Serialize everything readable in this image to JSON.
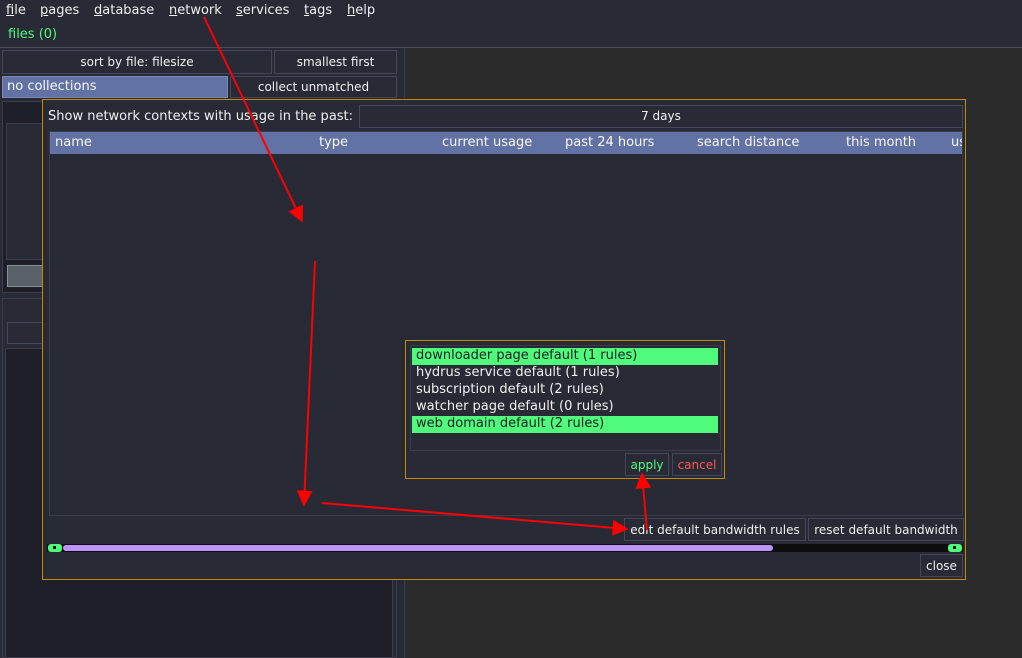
{
  "menubar": {
    "items": [
      {
        "key": "f",
        "rest": "ile"
      },
      {
        "key": "p",
        "rest": "ages"
      },
      {
        "key": "d",
        "rest": "atabase"
      },
      {
        "key": "n",
        "rest": "etwork"
      },
      {
        "key": "s",
        "rest": "ervices"
      },
      {
        "key": "t",
        "rest": "ags"
      },
      {
        "key": "h",
        "rest": "elp"
      }
    ]
  },
  "tabs": {
    "files_label": "files (0)"
  },
  "left_panel": {
    "sort_label": "sort by file: filesize",
    "order_label": "smallest first",
    "collections_label": "no collections",
    "collect_label": "collect unmatched"
  },
  "dialog": {
    "past_label": "Show network contexts with usage in the past:",
    "days_value": "7 days",
    "columns": [
      "name",
      "type",
      "current usage",
      "past 24 hours",
      "search distance",
      "this month",
      "us"
    ],
    "edit_default_label": "edit default bandwidth rules",
    "reset_default_label": "reset default bandwidth",
    "close_label": "close"
  },
  "popup": {
    "rows": [
      {
        "label": "downloader page default (1 rules)",
        "selected": true
      },
      {
        "label": "hydrus service default (1 rules)",
        "selected": false
      },
      {
        "label": "subscription default (2 rules)",
        "selected": false
      },
      {
        "label": "watcher page default (0 rules)",
        "selected": false
      },
      {
        "label": "web domain default (2 rules)",
        "selected": true
      }
    ],
    "apply_label": "apply",
    "cancel_label": "cancel"
  },
  "colors": {
    "accent_green": "#50fa7b",
    "accent_red": "#ff5555",
    "header_blue": "#6272a4",
    "dialog_border": "#c28a00",
    "scroll_thumb": "#bd93f9",
    "arrow_red": "#ff0000"
  }
}
